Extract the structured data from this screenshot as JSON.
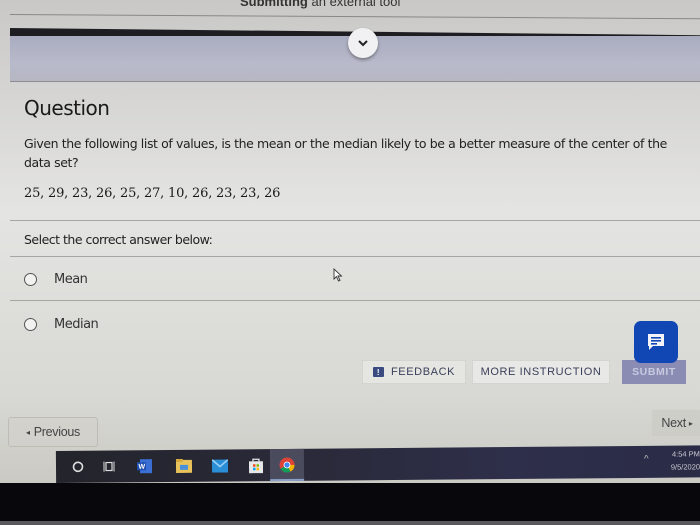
{
  "header": {
    "clipped_text_bold": "Submitting",
    "clipped_text_rest": " an external tool",
    "collapse_icon": "chevron-down-icon"
  },
  "question": {
    "title": "Question",
    "prompt": "Given the following list of values, is the mean or the median likely to be a better measure of the center of the data set?",
    "values": "25, 29, 23, 26, 25, 27, 10, 26, 23, 23, 26",
    "instruction": "Select the correct answer below:",
    "options": [
      {
        "label": "Mean",
        "selected": false
      },
      {
        "label": "Median",
        "selected": false
      }
    ]
  },
  "actions": {
    "feedback_label": "FEEDBACK",
    "feedback_icon": "feedback-icon",
    "more_instruction_label": "MORE INSTRUCTION",
    "submit_label": "SUBMIT",
    "chat_icon": "chat-message-icon"
  },
  "navigation": {
    "previous_label": "Previous",
    "previous_glyph": "◂",
    "next_label": "Next",
    "next_glyph": "▸"
  },
  "taskbar": {
    "icons": [
      "cortana-search-icon",
      "task-view-icon",
      "word-icon",
      "file-explorer-icon",
      "mail-icon",
      "store-icon",
      "chrome-icon"
    ],
    "active_app": "chrome-icon",
    "tray_chevron": "^",
    "time": "4:54 PM",
    "date": "9/5/2020"
  },
  "colors": {
    "brand_blue": "#1146b5",
    "submit_disabled": "#8a8cb4",
    "header_band": "#b8bacb",
    "taskbar": "#2a2b46"
  }
}
